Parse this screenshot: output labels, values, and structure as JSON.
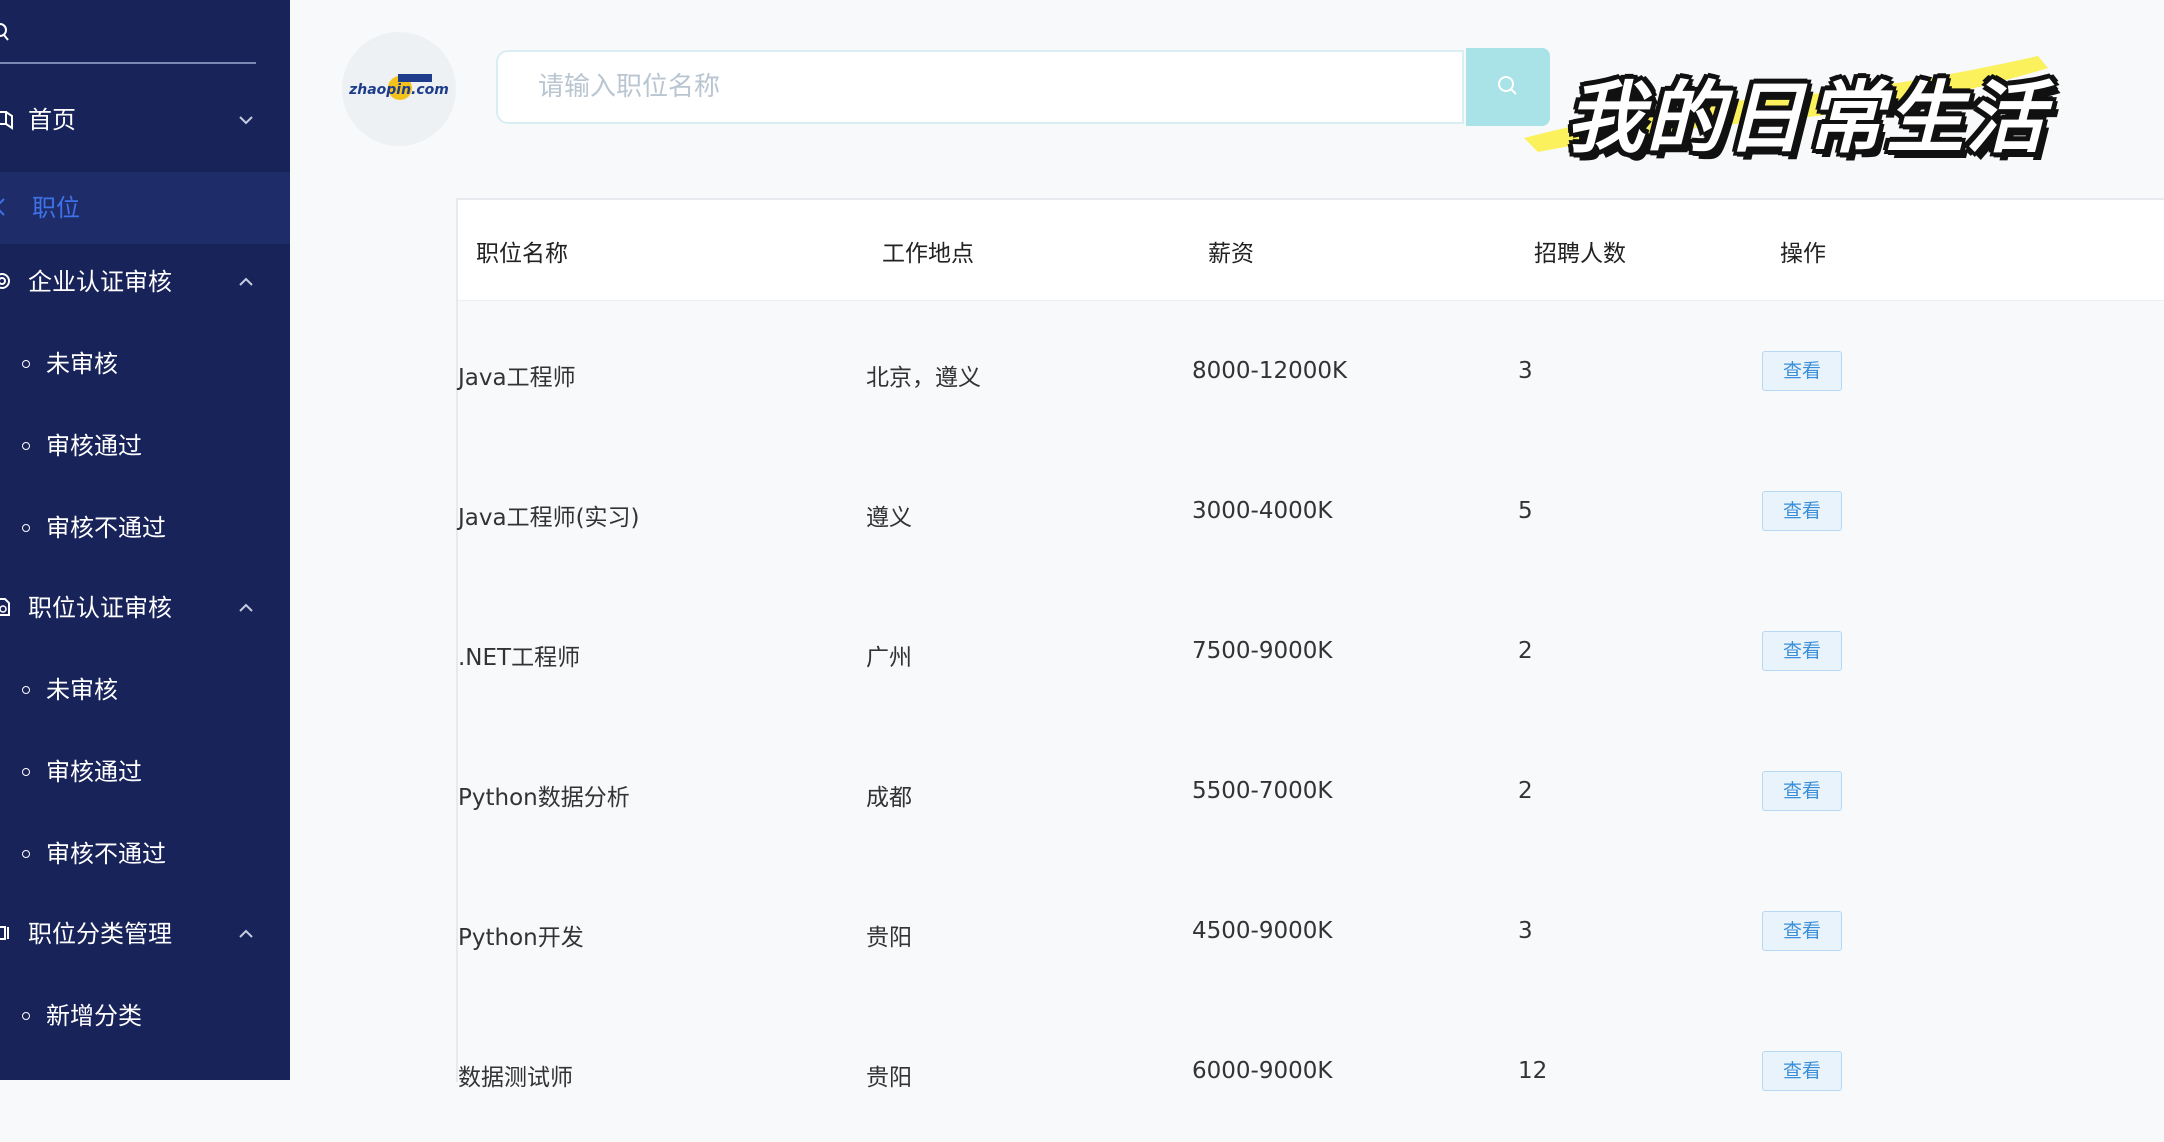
{
  "sidebar": {
    "search_placeholder": "",
    "groups": [
      {
        "label": "首页"
      },
      {
        "label": "职位"
      },
      {
        "label": "企业认证审核"
      },
      {
        "label": "职位认证审核"
      },
      {
        "label": "职位分类管理"
      }
    ],
    "enterprise_subs": [
      "未审核",
      "审核通过",
      "审核不通过"
    ],
    "position_subs": [
      "未审核",
      "审核通过",
      "审核不通过"
    ],
    "category_subs": [
      "新增分类"
    ]
  },
  "header": {
    "logo_text": "zhaopin.com",
    "search_placeholder": "请输入职位名称",
    "search_value": ""
  },
  "watermark": "我的日常生活",
  "table": {
    "headers": [
      "职位名称",
      "工作地点",
      "薪资",
      "招聘人数",
      "操作"
    ],
    "rows": [
      {
        "name": "Java工程师",
        "location": "北京，遵义",
        "salary": "8000-12000K",
        "count": "3",
        "action": "查看"
      },
      {
        "name": "Java工程师(实习)",
        "location": "遵义",
        "salary": "3000-4000K",
        "count": "5",
        "action": "查看"
      },
      {
        "name": ".NET工程师",
        "location": "广州",
        "salary": "7500-9000K",
        "count": "2",
        "action": "查看"
      },
      {
        "name": "Python数据分析",
        "location": "成都",
        "salary": "5500-7000K",
        "count": "2",
        "action": "查看"
      },
      {
        "name": "Python开发",
        "location": "贵阳",
        "salary": "4500-9000K",
        "count": "3",
        "action": "查看"
      },
      {
        "name": "数据测试师",
        "location": "贵阳",
        "salary": "6000-9000K",
        "count": "12",
        "action": "查看"
      }
    ]
  },
  "colors": {
    "sidebar_bg": "#18235a",
    "active_text": "#3f72e8",
    "search_button": "#a9e3e7",
    "view_button": "#3a8fd8"
  }
}
